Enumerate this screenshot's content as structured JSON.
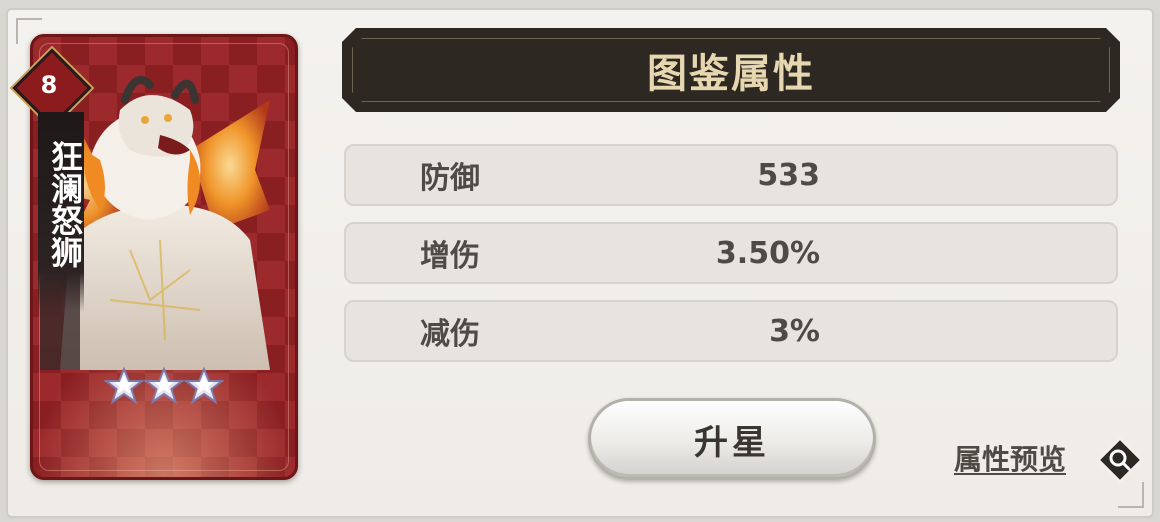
{
  "hero": {
    "level": "8",
    "name": "狂澜怒狮",
    "stars": 3
  },
  "panel": {
    "title": "图鉴属性"
  },
  "attributes": [
    {
      "label": "防御",
      "value": "533"
    },
    {
      "label": "增伤",
      "value": "3.50%"
    },
    {
      "label": "减伤",
      "value": "3%"
    }
  ],
  "actions": {
    "star_up_label": "升星",
    "preview_label": "属性预览"
  },
  "icons": {
    "preview": "magnifier-icon",
    "star": "star-icon"
  },
  "colors": {
    "card_red": "#8a1f22",
    "title_bg": "#2d2822",
    "title_text": "#e7d7b0",
    "text": "#4f4a44"
  }
}
